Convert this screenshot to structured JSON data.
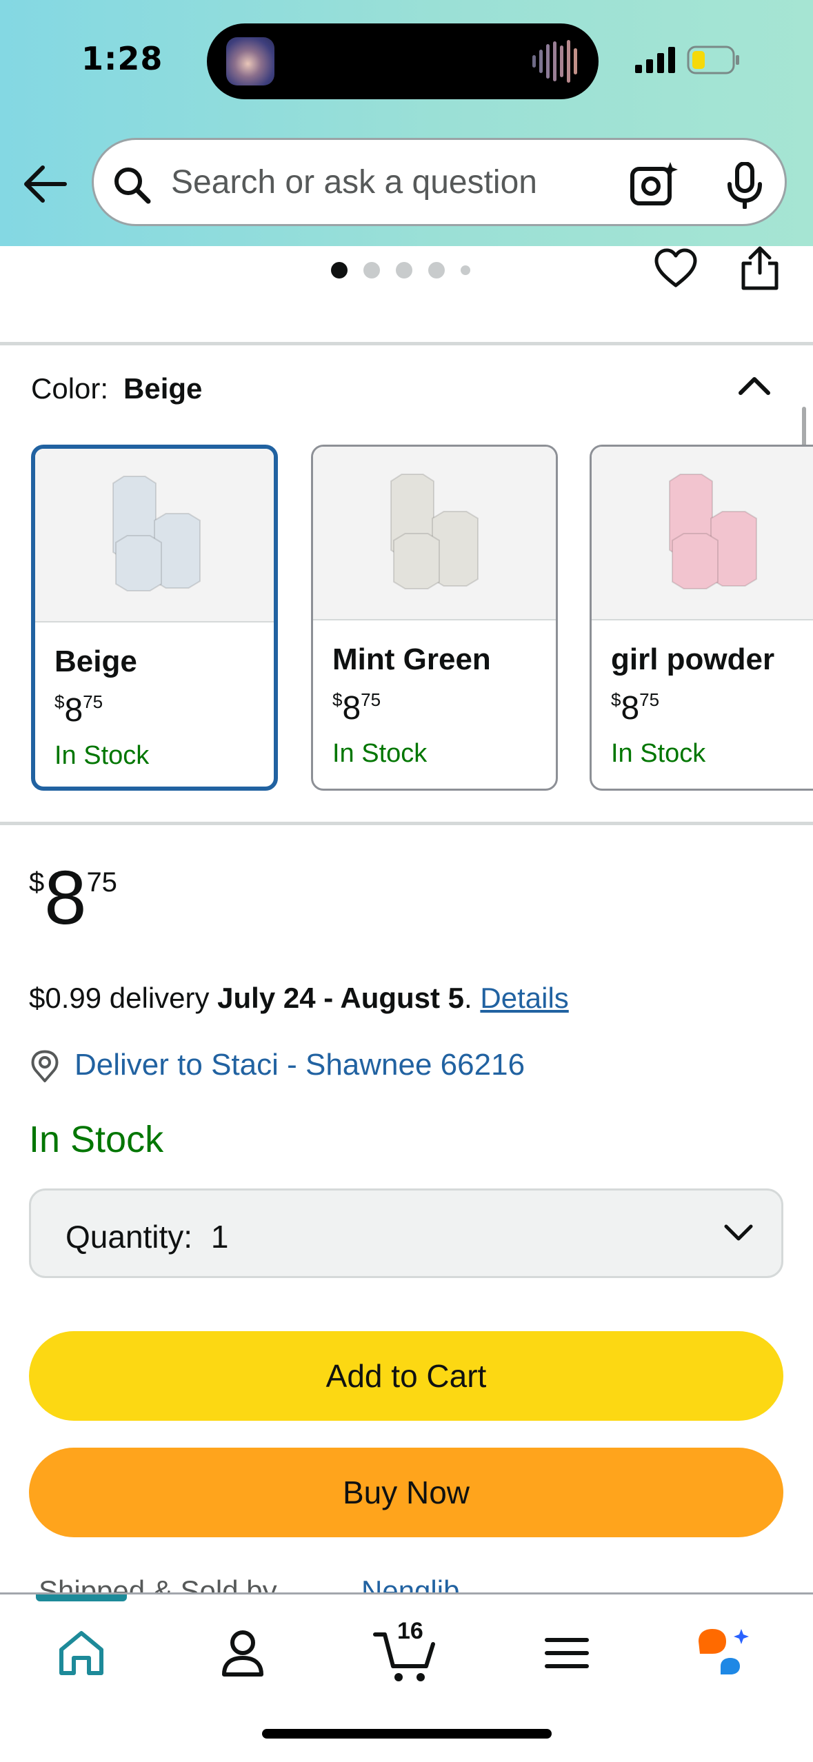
{
  "status_bar": {
    "time": "1:28"
  },
  "search": {
    "placeholder": "Search or ask a question"
  },
  "gallery": {
    "dot_count": 5,
    "active_index": 0
  },
  "color": {
    "label": "Color:",
    "selected": "Beige",
    "options": [
      {
        "name": "Beige",
        "currency": "$",
        "whole": "8",
        "fraction": "75",
        "stock": "In Stock",
        "swatch_color": "#dbe3ea"
      },
      {
        "name": "Mint Green",
        "currency": "$",
        "whole": "8",
        "fraction": "75",
        "stock": "In Stock",
        "swatch_color": "#e3e2dc"
      },
      {
        "name": "girl powder",
        "currency": "$",
        "whole": "8",
        "fraction": "75",
        "stock": "In Stock",
        "swatch_color": "#f2c4cf"
      }
    ]
  },
  "price": {
    "currency": "$",
    "whole": "8",
    "fraction": "75"
  },
  "delivery": {
    "fee": "$0.99 delivery",
    "dates": "July 24 - August 5",
    "period": ".",
    "details_link": "Details"
  },
  "deliver_to": "Deliver to Staci - Shawnee 66216",
  "availability": "In Stock",
  "quantity": {
    "label": "Quantity:",
    "value": "1"
  },
  "buttons": {
    "add_to_cart": "Add to Cart",
    "buy_now": "Buy Now"
  },
  "shipped": {
    "label": "Shipped & Sold by",
    "seller": "Nenglib"
  },
  "tabbar": {
    "cart_count": "16",
    "active": "home"
  },
  "colors": {
    "header_gradient_start": "#84d8e3",
    "header_gradient_end": "#a6e5d3",
    "link": "#2162a1",
    "in_stock": "#007600",
    "add_to_cart": "#fcd813",
    "buy_now": "#ffa41c",
    "selected_border": "#2162a1"
  }
}
